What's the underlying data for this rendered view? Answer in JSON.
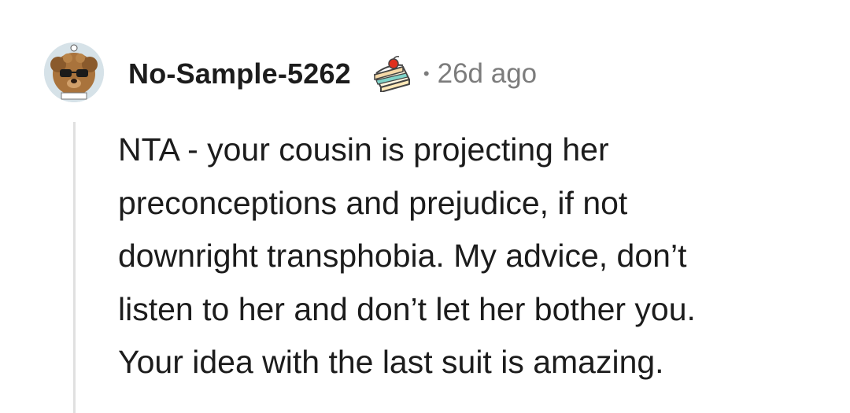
{
  "comment": {
    "username": "No-Sample-5262",
    "separator": "•",
    "timestamp": "26d ago",
    "avatar_icon": "dog-with-sunglasses-avatar-icon",
    "flair_icon": "cake-slice-icon",
    "body_lines": [
      "NTA - your cousin is projecting her",
      "preconceptions and prejudice, if not",
      "downright transphobia. My advice, don’t",
      "listen to her and don’t let her bother you.",
      "Your idea with the last suit is amazing."
    ]
  }
}
